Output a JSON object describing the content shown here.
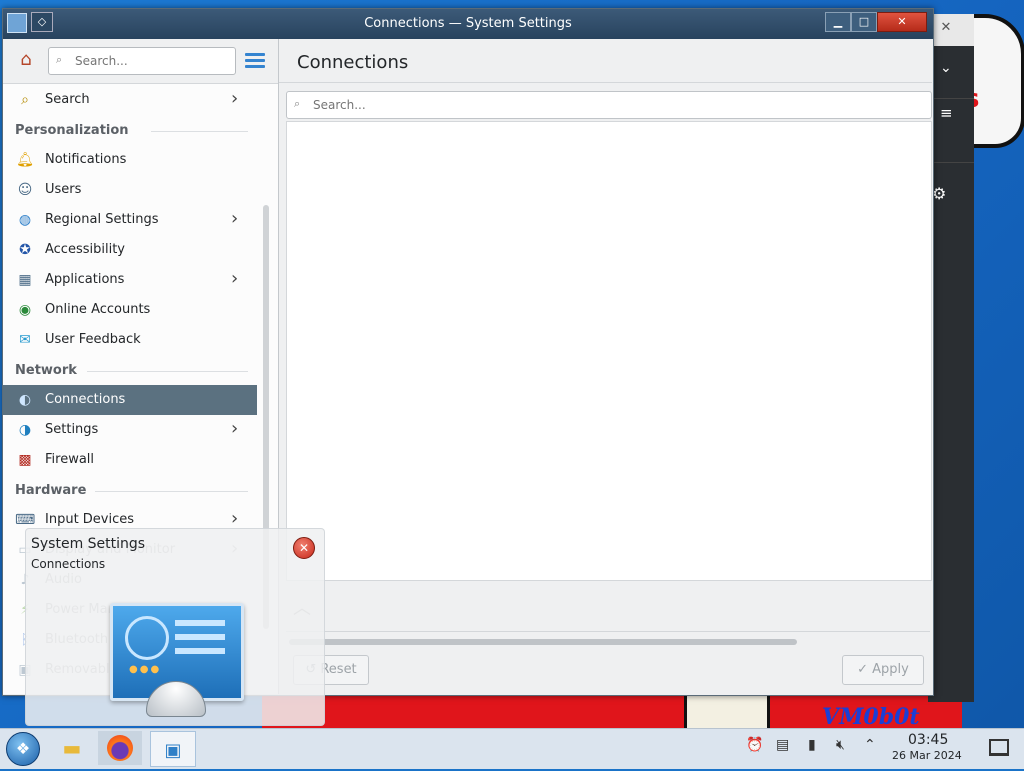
{
  "window": {
    "title": "Connections — System Settings",
    "buttons": {
      "minimize": "▁",
      "maximize": "□",
      "close": "✕"
    }
  },
  "sidebar": {
    "search_placeholder": "Search...",
    "items": [
      {
        "label": "Search",
        "icon": "search-icon",
        "arrow": true
      },
      {
        "category": "Personalization"
      },
      {
        "label": "Notifications",
        "icon": "bell-icon"
      },
      {
        "label": "Users",
        "icon": "users-icon"
      },
      {
        "label": "Regional Settings",
        "icon": "globe-icon",
        "arrow": true
      },
      {
        "label": "Accessibility",
        "icon": "accessibility-icon"
      },
      {
        "label": "Applications",
        "icon": "applications-icon",
        "arrow": true
      },
      {
        "label": "Online Accounts",
        "icon": "online-accounts-icon"
      },
      {
        "label": "User Feedback",
        "icon": "feedback-icon"
      },
      {
        "category": "Network"
      },
      {
        "label": "Connections",
        "icon": "network-connections-icon",
        "selected": true
      },
      {
        "label": "Settings",
        "icon": "network-settings-icon",
        "arrow": true
      },
      {
        "label": "Firewall",
        "icon": "firewall-icon"
      },
      {
        "category": "Hardware"
      },
      {
        "label": "Input Devices",
        "icon": "input-devices-icon",
        "arrow": true
      },
      {
        "label": "Display and Monitor",
        "icon": "display-icon",
        "arrow": true
      },
      {
        "label": "Audio",
        "icon": "audio-icon"
      },
      {
        "label": "Power Management",
        "icon": "power-icon"
      },
      {
        "label": "Bluetooth",
        "icon": "bluetooth-icon"
      },
      {
        "label": "Removable Storage",
        "icon": "removable-storage-icon"
      }
    ]
  },
  "content": {
    "title": "Connections",
    "search_placeholder": "Search...",
    "reset_label": "Reset",
    "apply_label": "Apply"
  },
  "popup": {
    "title": "System Settings",
    "subtitle": "Connections"
  },
  "taskbar": {
    "time": "03:45",
    "date": "26 Mar 2024"
  },
  "wallpaper": {
    "text": "VM0b0t"
  },
  "colors": {
    "titlebar": "#28435e",
    "selection": "#5b7180",
    "accent": "#3484d0",
    "close": "#c8281a"
  }
}
